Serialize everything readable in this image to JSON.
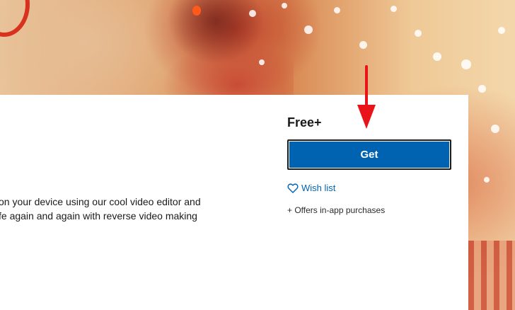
{
  "store": {
    "description_lines": [
      "on your device using our cool video editor and",
      "fe again and again with reverse video making"
    ],
    "price": "Free+",
    "get_label": "Get",
    "wishlist_label": "Wish list",
    "offers_label": "+ Offers in-app purchases"
  },
  "colors": {
    "button_blue": "#0063b1",
    "link_blue": "#0063b1",
    "annotation_red": "#e8141a"
  },
  "icons": {
    "wishlist": "heart-outline-icon",
    "annotation": "red-arrow-down-icon"
  }
}
